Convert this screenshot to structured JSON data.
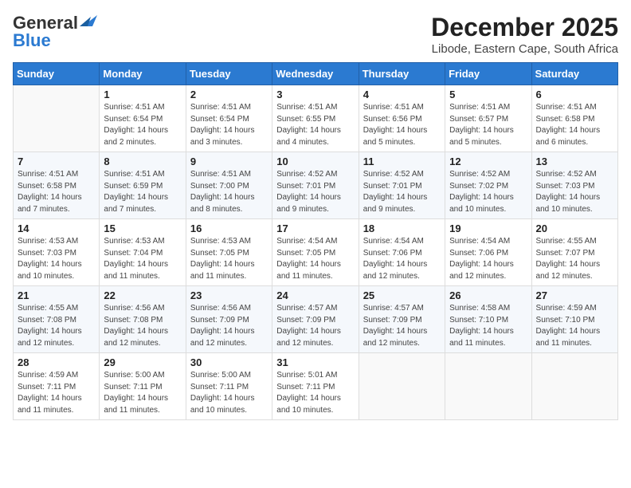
{
  "logo": {
    "general": "General",
    "blue": "Blue"
  },
  "header": {
    "month": "December 2025",
    "location": "Libode, Eastern Cape, South Africa"
  },
  "weekdays": [
    "Sunday",
    "Monday",
    "Tuesday",
    "Wednesday",
    "Thursday",
    "Friday",
    "Saturday"
  ],
  "weeks": [
    [
      {
        "day": "",
        "detail": ""
      },
      {
        "day": "1",
        "detail": "Sunrise: 4:51 AM\nSunset: 6:54 PM\nDaylight: 14 hours\nand 2 minutes."
      },
      {
        "day": "2",
        "detail": "Sunrise: 4:51 AM\nSunset: 6:54 PM\nDaylight: 14 hours\nand 3 minutes."
      },
      {
        "day": "3",
        "detail": "Sunrise: 4:51 AM\nSunset: 6:55 PM\nDaylight: 14 hours\nand 4 minutes."
      },
      {
        "day": "4",
        "detail": "Sunrise: 4:51 AM\nSunset: 6:56 PM\nDaylight: 14 hours\nand 5 minutes."
      },
      {
        "day": "5",
        "detail": "Sunrise: 4:51 AM\nSunset: 6:57 PM\nDaylight: 14 hours\nand 5 minutes."
      },
      {
        "day": "6",
        "detail": "Sunrise: 4:51 AM\nSunset: 6:58 PM\nDaylight: 14 hours\nand 6 minutes."
      }
    ],
    [
      {
        "day": "7",
        "detail": "Sunrise: 4:51 AM\nSunset: 6:58 PM\nDaylight: 14 hours\nand 7 minutes."
      },
      {
        "day": "8",
        "detail": "Sunrise: 4:51 AM\nSunset: 6:59 PM\nDaylight: 14 hours\nand 7 minutes."
      },
      {
        "day": "9",
        "detail": "Sunrise: 4:51 AM\nSunset: 7:00 PM\nDaylight: 14 hours\nand 8 minutes."
      },
      {
        "day": "10",
        "detail": "Sunrise: 4:52 AM\nSunset: 7:01 PM\nDaylight: 14 hours\nand 9 minutes."
      },
      {
        "day": "11",
        "detail": "Sunrise: 4:52 AM\nSunset: 7:01 PM\nDaylight: 14 hours\nand 9 minutes."
      },
      {
        "day": "12",
        "detail": "Sunrise: 4:52 AM\nSunset: 7:02 PM\nDaylight: 14 hours\nand 10 minutes."
      },
      {
        "day": "13",
        "detail": "Sunrise: 4:52 AM\nSunset: 7:03 PM\nDaylight: 14 hours\nand 10 minutes."
      }
    ],
    [
      {
        "day": "14",
        "detail": "Sunrise: 4:53 AM\nSunset: 7:03 PM\nDaylight: 14 hours\nand 10 minutes."
      },
      {
        "day": "15",
        "detail": "Sunrise: 4:53 AM\nSunset: 7:04 PM\nDaylight: 14 hours\nand 11 minutes."
      },
      {
        "day": "16",
        "detail": "Sunrise: 4:53 AM\nSunset: 7:05 PM\nDaylight: 14 hours\nand 11 minutes."
      },
      {
        "day": "17",
        "detail": "Sunrise: 4:54 AM\nSunset: 7:05 PM\nDaylight: 14 hours\nand 11 minutes."
      },
      {
        "day": "18",
        "detail": "Sunrise: 4:54 AM\nSunset: 7:06 PM\nDaylight: 14 hours\nand 12 minutes."
      },
      {
        "day": "19",
        "detail": "Sunrise: 4:54 AM\nSunset: 7:06 PM\nDaylight: 14 hours\nand 12 minutes."
      },
      {
        "day": "20",
        "detail": "Sunrise: 4:55 AM\nSunset: 7:07 PM\nDaylight: 14 hours\nand 12 minutes."
      }
    ],
    [
      {
        "day": "21",
        "detail": "Sunrise: 4:55 AM\nSunset: 7:08 PM\nDaylight: 14 hours\nand 12 minutes."
      },
      {
        "day": "22",
        "detail": "Sunrise: 4:56 AM\nSunset: 7:08 PM\nDaylight: 14 hours\nand 12 minutes."
      },
      {
        "day": "23",
        "detail": "Sunrise: 4:56 AM\nSunset: 7:09 PM\nDaylight: 14 hours\nand 12 minutes."
      },
      {
        "day": "24",
        "detail": "Sunrise: 4:57 AM\nSunset: 7:09 PM\nDaylight: 14 hours\nand 12 minutes."
      },
      {
        "day": "25",
        "detail": "Sunrise: 4:57 AM\nSunset: 7:09 PM\nDaylight: 14 hours\nand 12 minutes."
      },
      {
        "day": "26",
        "detail": "Sunrise: 4:58 AM\nSunset: 7:10 PM\nDaylight: 14 hours\nand 11 minutes."
      },
      {
        "day": "27",
        "detail": "Sunrise: 4:59 AM\nSunset: 7:10 PM\nDaylight: 14 hours\nand 11 minutes."
      }
    ],
    [
      {
        "day": "28",
        "detail": "Sunrise: 4:59 AM\nSunset: 7:11 PM\nDaylight: 14 hours\nand 11 minutes."
      },
      {
        "day": "29",
        "detail": "Sunrise: 5:00 AM\nSunset: 7:11 PM\nDaylight: 14 hours\nand 11 minutes."
      },
      {
        "day": "30",
        "detail": "Sunrise: 5:00 AM\nSunset: 7:11 PM\nDaylight: 14 hours\nand 10 minutes."
      },
      {
        "day": "31",
        "detail": "Sunrise: 5:01 AM\nSunset: 7:11 PM\nDaylight: 14 hours\nand 10 minutes."
      },
      {
        "day": "",
        "detail": ""
      },
      {
        "day": "",
        "detail": ""
      },
      {
        "day": "",
        "detail": ""
      }
    ]
  ]
}
